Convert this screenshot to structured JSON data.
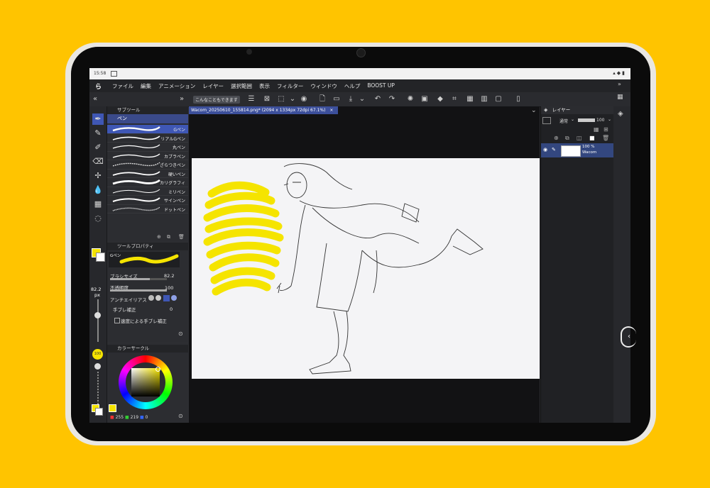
{
  "status_bar": {
    "time": "15:58"
  },
  "menu": {
    "logo": "ら",
    "items": [
      "ファイル",
      "編集",
      "アニメーション",
      "レイヤー",
      "選択範囲",
      "表示",
      "フィルター",
      "ウィンドウ",
      "ヘルプ",
      "BOOST UP"
    ]
  },
  "command_bar": {
    "hint": "こんなこともできます"
  },
  "document": {
    "tab_title": "Wacom_20250610_155814.png* (2094 x 1334px 72dpi 67.1%)"
  },
  "subtool": {
    "panel_title": "サブツール",
    "group_tab": "ペン",
    "brushes": [
      "Gペン",
      "リアルGペン",
      "丸ペン",
      "カブラペン",
      "ざらつきペン",
      "硬いペン",
      "カリグラフィ",
      "ミリペン",
      "サインペン",
      "ドットペン"
    ],
    "selected_index": 0
  },
  "tool_property": {
    "panel_title": "ツールプロパティ",
    "preview_label": "Gペン",
    "brush_size_label": "ブラシサイズ",
    "brush_size_value": "82.2",
    "opacity_label": "不透明度",
    "opacity_value": "100",
    "antialias_label": "アンチエイリアス",
    "stabilize_label": "手ブレ補正",
    "stabilize_value": "0",
    "speed_stabilize_label": "速度による手ブレ補正"
  },
  "left_column": {
    "size_value": "82.2",
    "size_unit": "px",
    "opacity_badge": "100"
  },
  "color_circle": {
    "panel_title": "カラーサークル",
    "r": "255",
    "g": "219",
    "b": "0",
    "current_color": "#F5E400"
  },
  "layer_panel": {
    "title": "レイヤー",
    "blend_mode": "通常",
    "opacity": "100",
    "layer_opacity_label": "100 %",
    "layer_name": "Wacom"
  },
  "colors": {
    "accent": "#3F57B5",
    "background": "#FFC400",
    "highlight_yellow": "#F5E400"
  }
}
